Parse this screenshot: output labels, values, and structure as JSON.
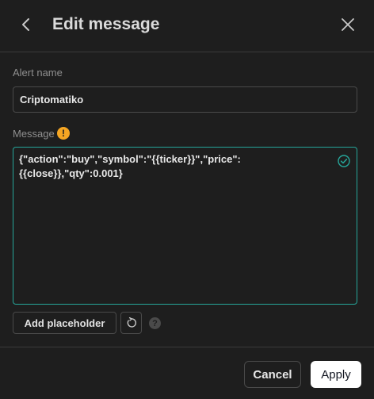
{
  "header": {
    "title": "Edit message",
    "back_icon": "chevron-left-icon",
    "close_icon": "close-icon"
  },
  "alert_name": {
    "label": "Alert name",
    "value": "Criptomatiko"
  },
  "message": {
    "label": "Message",
    "warning_icon": "warning-icon",
    "text": "{\"action\":\"buy\",\"symbol\":\"{{ticker}}\",\"price\":\n{{close}},\"qty\":0.001}",
    "valid_icon": "check-circle-icon"
  },
  "toolbar": {
    "add_placeholder_label": "Add placeholder",
    "reset_icon": "reset-icon",
    "help_icon": "help-icon"
  },
  "footer": {
    "cancel_label": "Cancel",
    "apply_label": "Apply"
  },
  "colors": {
    "background": "#1e1e1e",
    "accent_valid": "#26a69a",
    "warning": "#f5a623",
    "primary_button_bg": "#ffffff"
  }
}
